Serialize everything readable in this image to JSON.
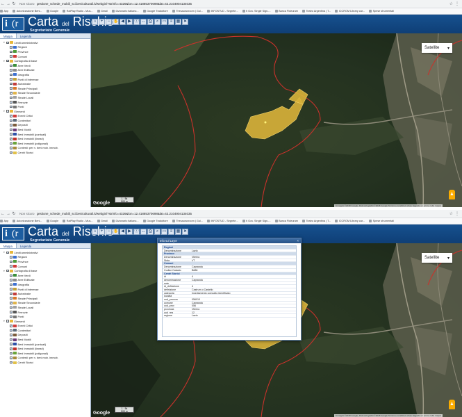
{
  "browser": {
    "url_prefix": "Non sicuro",
    "url": "gestione_schede_mobili_sci.beniculturali.it/webgis/?strinfo=4326&lon=12.41885370698&lat=42.2104904134035",
    "bookmarks": [
      "App",
      "Autorizzazione Beni...",
      "Google",
      "RaiPlay Radio - Mus...",
      "Gmail",
      "Dizionario italiano...",
      "Google Traduttore",
      "Thesaurusroom | Gui...",
      "INFOSTUD - Segrete...",
      "ti Gov. Single Sign-...",
      "Banca Fideuram",
      "Teatro Argentina | T...",
      "ICCROM Library car...",
      "Spese strumentali"
    ]
  },
  "app": {
    "logo_text": "i",
    "title_main": "Carta",
    "title_small": "del",
    "title_end": "Rischio",
    "subtitle": "Segretariato Generale",
    "toolbar_icons": [
      "home-icon",
      "zoom-in-icon",
      "zoom-out-icon",
      "pan-icon",
      "back-icon",
      "forward-icon",
      "info-icon",
      "measure-icon",
      "print-icon",
      "search-icon",
      "select-icon",
      "layers-icon",
      "grid-icon",
      "arrow-icon"
    ]
  },
  "panel": {
    "tabs": [
      "Mappa",
      "Legenda"
    ],
    "tree": [
      {
        "label": "Limiti amministrativi",
        "level": 0,
        "color": "#e8b73a"
      },
      {
        "label": "Regioni",
        "level": 1,
        "color": "#3a6fd1"
      },
      {
        "label": "Province",
        "level": 1,
        "color": "#4d9a3a"
      },
      {
        "label": "Comuni",
        "level": 1,
        "color": "#d23b3b"
      },
      {
        "label": "Cartografia di base",
        "level": 0,
        "color": "#e8b73a"
      },
      {
        "label": "Aree Verdi",
        "level": 1,
        "color": "#3b8f3b"
      },
      {
        "label": "Aree Edificate",
        "level": 1,
        "color": "#8a8a8a"
      },
      {
        "label": "Idrografia",
        "level": 1,
        "color": "#3b6fd1"
      },
      {
        "label": "Punti di Interesse",
        "level": 1,
        "color": "#c2a23a"
      },
      {
        "label": "Autostrade",
        "level": 1,
        "color": "#c23b3b"
      },
      {
        "label": "Strade Principali",
        "level": 1,
        "color": "#d9792b"
      },
      {
        "label": "Strade Secondarie",
        "level": 1,
        "color": "#e0b44a"
      },
      {
        "label": "Strade Locali",
        "level": 1,
        "color": "#a0a0a0"
      },
      {
        "label": "Ferrovie",
        "level": 1,
        "color": "#555555"
      },
      {
        "label": "Ponti",
        "level": 1,
        "color": "#777777"
      },
      {
        "label": "Elementi",
        "level": 0,
        "color": "#e8b73a"
      },
      {
        "label": "Eventi Critici",
        "level": 1,
        "color": "#d13b3b"
      },
      {
        "label": "Contenitori",
        "level": 1,
        "color": "#5b6b7a"
      },
      {
        "label": "Depositi",
        "level": 1,
        "color": "#7a5b3a"
      },
      {
        "label": "Beni Mobili",
        "level": 1,
        "color": "#6b3a7a"
      },
      {
        "label": "Beni Immobili (puntuali)",
        "level": 1,
        "color": "#2b4fa8"
      },
      {
        "label": "Beni Immobili (lineari)",
        "level": 1,
        "color": "#c2312b"
      },
      {
        "label": "Beni Immobili (poligonali)",
        "level": 1,
        "color": "#6aa33a"
      },
      {
        "label": "Contesti: per n. beni mob. immob.",
        "level": 1,
        "color": "#a88a3a"
      },
      {
        "label": "Centri Storici",
        "level": 1,
        "color": "#e2c14a"
      }
    ]
  },
  "map": {
    "layer_button": "Satellite",
    "google": "Google",
    "scale_text": "1 : 5k",
    "scale_sub": "500 m",
    "attribution": "Immagini ©2018 Google, Dati cartografici ©2018 Google   Termini e condizioni d'uso   Segnala un errore nella mappa"
  },
  "popup": {
    "title": "Info sul Layer",
    "close": "×",
    "rows": [
      {
        "k": "Regioni",
        "v": "",
        "hdr": true
      },
      {
        "k": "Denominazione",
        "v": "Lazio"
      },
      {
        "k": "Province",
        "v": "",
        "hdr": true
      },
      {
        "k": "Denominazione",
        "v": "Viterbo"
      },
      {
        "k": "Sigla",
        "v": "VT"
      },
      {
        "k": "Comuni",
        "v": "",
        "hdr": true
      },
      {
        "k": "Denominazione",
        "v": "Caprarola"
      },
      {
        "k": "Codice Catasto",
        "v": "B688"
      },
      {
        "k": "Centri Storici",
        "v": "",
        "hdr": true
      },
      {
        "k": "id",
        "v": "4"
      },
      {
        "k": "denominazione",
        "v": "Caprarola"
      },
      {
        "k": "note",
        "v": ""
      },
      {
        "k": "id_definizione",
        "v": "4"
      },
      {
        "k": "definizione",
        "v": "Castrum o Castello"
      },
      {
        "k": "categoria",
        "v": "Insediamento compatto identificato"
      },
      {
        "k": "località",
        "v": ""
      },
      {
        "k": "cod_procom",
        "v": "056010"
      },
      {
        "k": "comune",
        "v": "Caprarola"
      },
      {
        "k": "cod_prov",
        "v": "056"
      },
      {
        "k": "provincia",
        "v": "Viterbo"
      },
      {
        "k": "cod_reg",
        "v": "12"
      },
      {
        "k": "regione",
        "v": "Lazio"
      }
    ]
  }
}
